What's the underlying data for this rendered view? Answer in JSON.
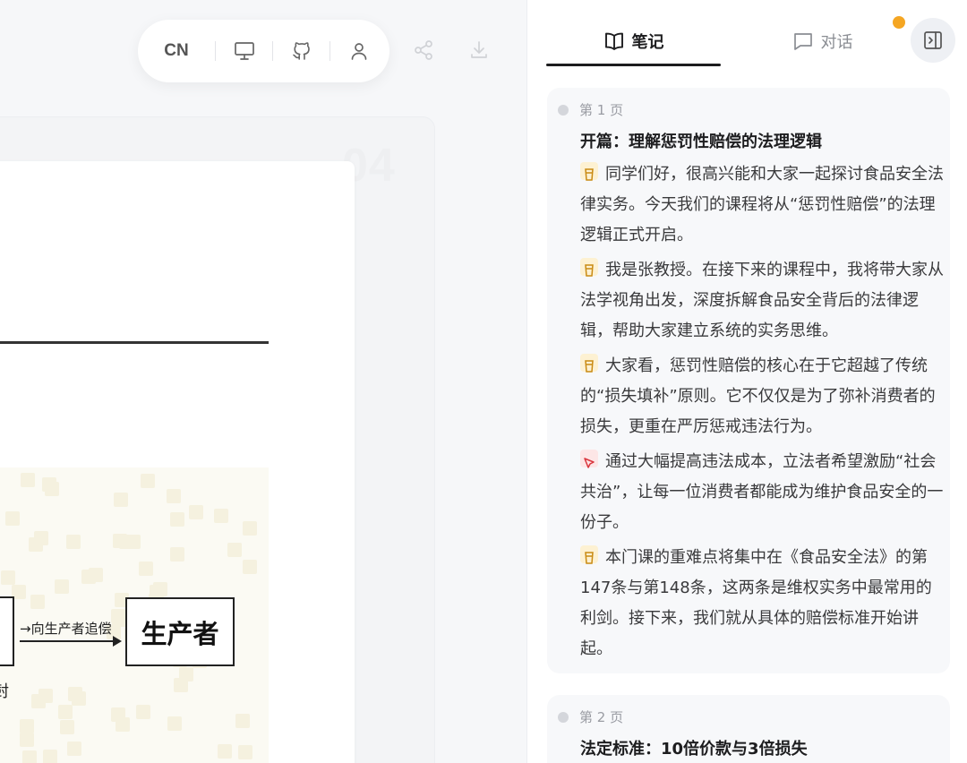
{
  "toolbar": {
    "lang_label": "CN",
    "icons": [
      "monitor-icon",
      "github-icon",
      "user-icon",
      "share-icon",
      "download-icon"
    ]
  },
  "slide": {
    "page_number": "04",
    "arrow_label": "→向生产者追偿",
    "producer_label": "生产者",
    "cut_text": "尌"
  },
  "panel": {
    "tabs": [
      {
        "label": "笔记",
        "icon": "book-icon",
        "active": true
      },
      {
        "label": "对话",
        "icon": "chat-icon",
        "active": false
      }
    ],
    "notification_color": "#f5a623"
  },
  "notes": [
    {
      "page": "第 1 页",
      "title": "开篇：理解惩罚性赔偿的法理逻辑",
      "paragraphs": [
        {
          "icon": "cup-icon",
          "text": "同学们好，很高兴能和大家一起探讨食品安全法律实务。今天我们的课程将从“惩罚性赔偿”的法理逻辑正式开启。"
        },
        {
          "icon": "cup-icon",
          "text": "我是张教授。在接下来的课程中，我将带大家从法学视角出发，深度拆解食品安全背后的法律逻辑，帮助大家建立系统的实务思维。"
        },
        {
          "icon": "cup-icon",
          "text": "大家看，惩罚性赔偿的核心在于它超越了传统的“损失填补”原则。它不仅仅是为了弥补消费者的损失，更重在严厉惩戒违法行为。"
        },
        {
          "icon": "cursor-icon",
          "text": "通过大幅提高违法成本，立法者希望激励“社会共治”，让每一位消费者都能成为维护食品安全的一份子。"
        },
        {
          "icon": "cup-icon",
          "text": "本门课的重难点将集中在《食品安全法》的第147条与第148条，这两条是维权实务中最常用的利剑。接下来，我们就从具体的赔偿标准开始讲起。"
        }
      ]
    },
    {
      "page": "第 2 页",
      "title": "法定标准：10倍价款与3倍损失",
      "paragraphs": []
    }
  ]
}
